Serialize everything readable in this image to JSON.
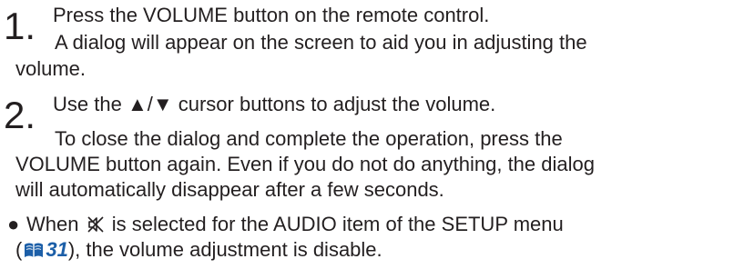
{
  "steps": [
    {
      "number": "1",
      "dot": ".",
      "heading": "Press the VOLUME button on the remote control.",
      "detail_line1": "A dialog will appear on the screen to aid you in adjusting the",
      "detail_line2": "volume."
    },
    {
      "number": "2",
      "dot": ".",
      "heading_prefix": "Use the ",
      "arrow_up": "▲",
      "slash": "/",
      "arrow_down": "▼",
      "heading_suffix": " cursor buttons to adjust the volume.",
      "detail_line1": "To close the dialog and complete the operation, press the",
      "detail_line2": "VOLUME button again. Even if you do not do anything, the dialog",
      "detail_line3": "will automatically disappear after a few seconds."
    }
  ],
  "note": {
    "bullet": "●",
    "line1_prefix": "When ",
    "mute_icon": "mute-icon",
    "line1_suffix": " is selected for the AUDIO item of the SETUP menu",
    "line2_open": "(",
    "book_icon": "manual-book-icon",
    "page_ref": "31",
    "line2_close": "), the volume adjustment is disable."
  },
  "colors": {
    "text": "#231f20",
    "page_ref": "#1c5fa8"
  }
}
